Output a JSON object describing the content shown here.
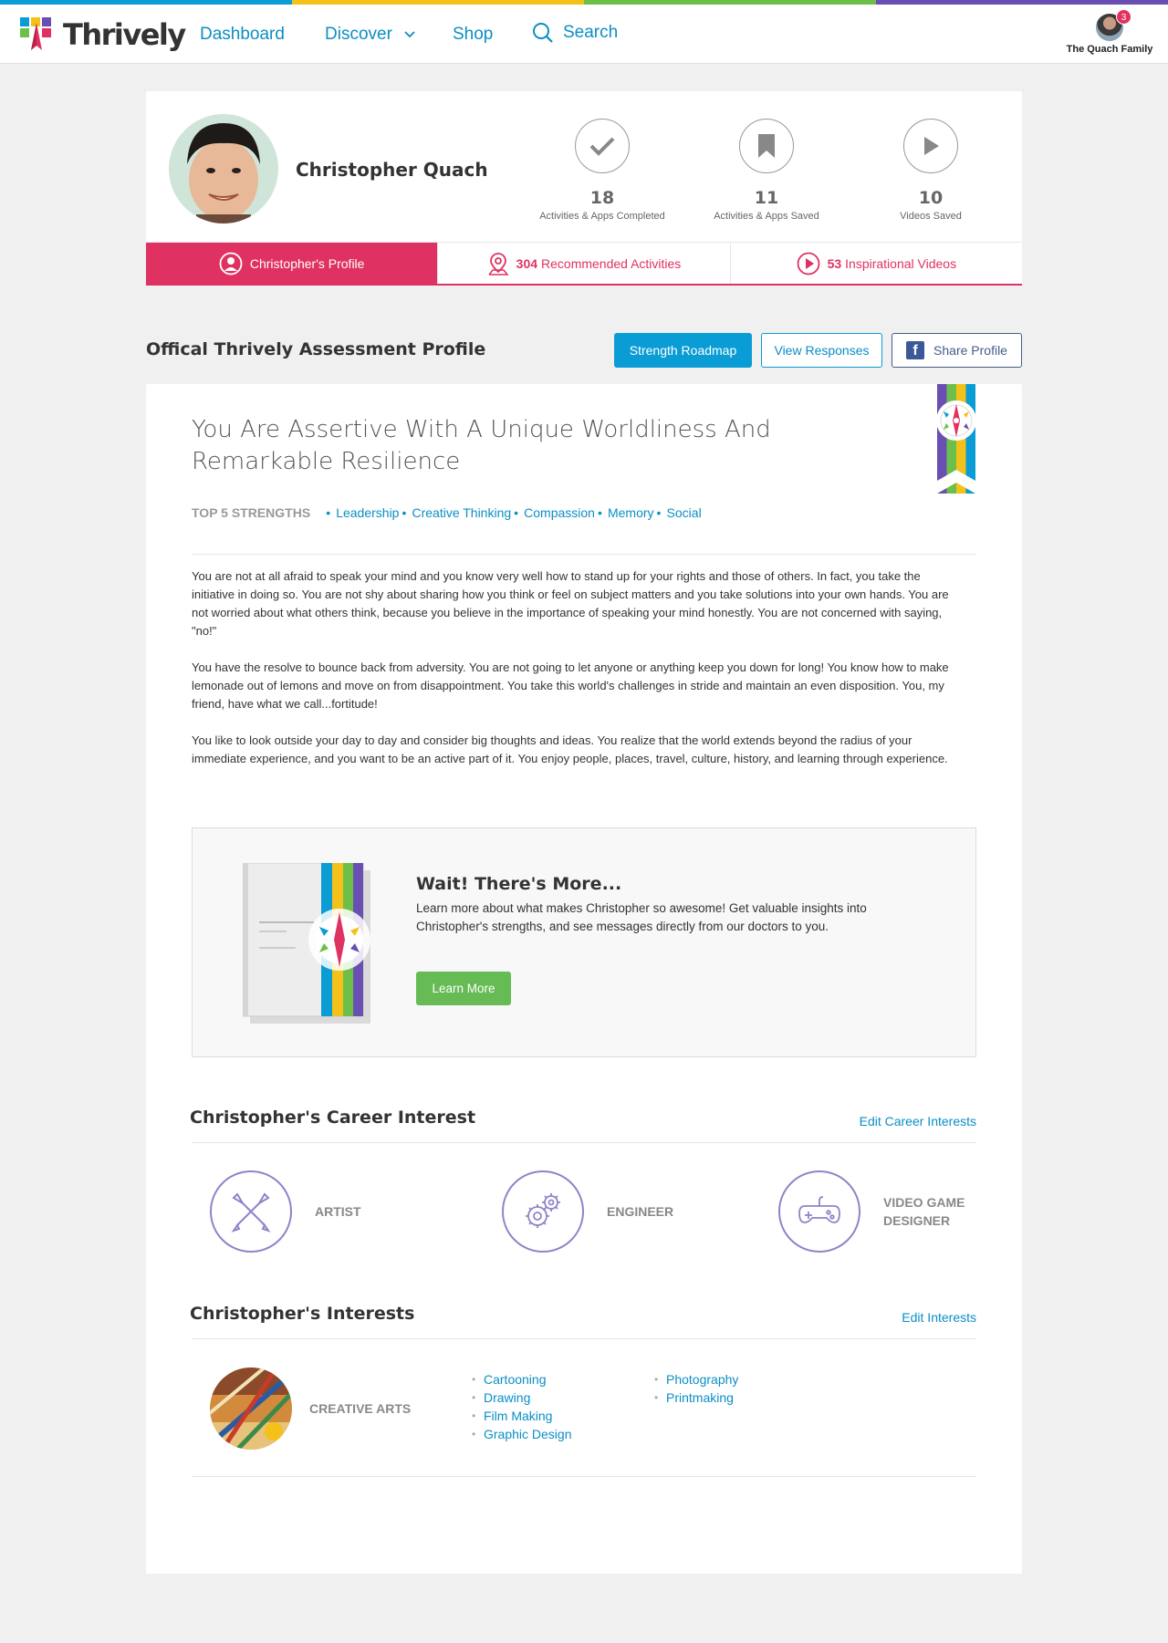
{
  "colors": {
    "stripe": [
      "#0a9cd4",
      "#f4c11b",
      "#6cc04a",
      "#6a4fb2"
    ],
    "primary": "#0a9cd4",
    "accent": "#e03262",
    "green": "#66bb55",
    "career_purple": "#8f84c8"
  },
  "header": {
    "logo_text": "Thrively",
    "nav": {
      "dashboard": "Dashboard",
      "discover": "Discover",
      "shop": "Shop",
      "search": "Search"
    },
    "account": {
      "name": "The Quach Family",
      "notifications": "3"
    }
  },
  "profile": {
    "name": "Christopher Quach",
    "stats": [
      {
        "icon": "check-icon",
        "value": "18",
        "label": "Activities & Apps Completed"
      },
      {
        "icon": "bookmark-icon",
        "value": "11",
        "label": "Activities & Apps Saved"
      },
      {
        "icon": "play-icon",
        "value": "10",
        "label": "Videos Saved"
      }
    ],
    "tabs": [
      {
        "icon": "person-icon",
        "count": "",
        "label": "Christopher's Profile"
      },
      {
        "icon": "map-pin-icon",
        "count": "304",
        "label": "Recommended Activities"
      },
      {
        "icon": "play-circle-icon",
        "count": "53",
        "label": "Inspirational Videos"
      }
    ]
  },
  "assessment": {
    "title": "Offical Thrively Assessment Profile",
    "buttons": {
      "roadmap": "Strength Roadmap",
      "responses": "View Responses",
      "share": "Share Profile"
    },
    "headline": "You Are Assertive With A Unique Worldliness And Remarkable Resilience",
    "strengths_label": "TOP 5 STRENGTHS",
    "strengths": [
      "Leadership",
      "Creative Thinking",
      "Compassion",
      "Memory",
      "Social"
    ],
    "paragraphs": [
      "You are not at all afraid to speak your mind and you know very well how to stand up for your rights and those of others. In fact, you take the initiative in doing so. You are not shy about sharing how you think or feel on subject matters and you take solutions into your own hands. You are not worried about what others think, because you believe in the importance of speaking your mind honestly. You are not concerned with saying, \"no!\"",
      "You have the resolve to bounce back from adversity. You are not going to let anyone or anything keep you down for long! You know how to make lemonade out of lemons and move on from disappointment. You take this world's challenges in stride and maintain an even disposition. You, my friend, have what we call...fortitude!",
      "You like to look outside your day to day and consider big thoughts and ideas. You realize that the world extends beyond the radius of your immediate experience, and you want to be an active part of it. You enjoy people, places, travel, culture, history, and learning through experience."
    ]
  },
  "more": {
    "title": "Wait! There's More...",
    "text": "Learn more about what makes Christopher so awesome! Get valuable insights into Christopher's strengths, and see messages directly from our doctors to you.",
    "button": "Learn More"
  },
  "career": {
    "title": "Christopher's Career Interest",
    "edit": "Edit Career Interests",
    "items": [
      {
        "icon": "paintbrush-icon",
        "label": "ARTIST"
      },
      {
        "icon": "gears-icon",
        "label": "ENGINEER"
      },
      {
        "icon": "gamepad-icon",
        "label": "VIDEO GAME DESIGNER"
      }
    ]
  },
  "interests": {
    "title": "Christopher's Interests",
    "edit": "Edit Interests",
    "category": "CREATIVE ARTS",
    "items_col1": [
      "Cartooning",
      "Drawing",
      "Film Making",
      "Graphic Design"
    ],
    "items_col2": [
      "Photography",
      "Printmaking"
    ]
  }
}
